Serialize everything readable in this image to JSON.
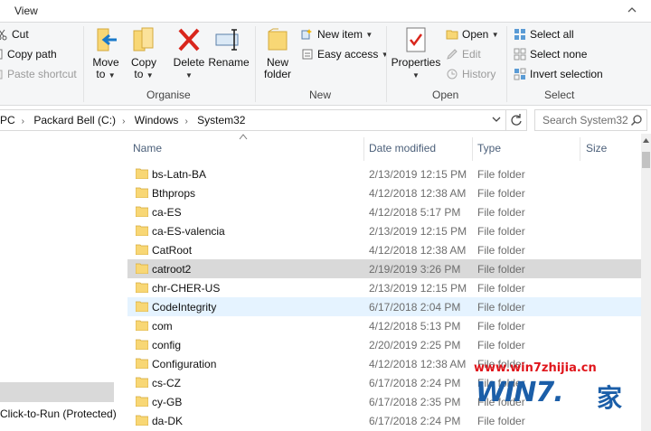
{
  "tabbar": {
    "view_tab": "View"
  },
  "ribbon": {
    "clipboard": {
      "cut": "Cut",
      "copy_path": "Copy path",
      "paste_shortcut": "Paste shortcut"
    },
    "organise": {
      "label": "Organise",
      "move_to": "Move",
      "move_to_2": "to",
      "copy_to": "Copy",
      "copy_to_2": "to",
      "delete": "Delete",
      "rename": "Rename"
    },
    "new": {
      "label": "New",
      "new_folder": "New",
      "new_folder_2": "folder",
      "new_item": "New item",
      "easy_access": "Easy access"
    },
    "open": {
      "label": "Open",
      "properties": "Properties",
      "open": "Open",
      "edit": "Edit",
      "history": "History"
    },
    "select": {
      "label": "Select",
      "select_all": "Select all",
      "select_none": "Select none",
      "invert": "Invert selection"
    }
  },
  "address": {
    "crumbs": [
      "PC",
      "Packard Bell (C:)",
      "Windows",
      "System32"
    ],
    "search_placeholder": "Search System32"
  },
  "navpane": {
    "bottom_item": "Click-to-Run (Protected)"
  },
  "list": {
    "headers": {
      "name": "Name",
      "date": "Date modified",
      "type": "Type",
      "size": "Size"
    },
    "rows": [
      {
        "name": "bs-Latn-BA",
        "date": "2/13/2019 12:15 PM",
        "type": "File folder"
      },
      {
        "name": "Bthprops",
        "date": "4/12/2018 12:38 AM",
        "type": "File folder"
      },
      {
        "name": "ca-ES",
        "date": "4/12/2018 5:17 PM",
        "type": "File folder"
      },
      {
        "name": "ca-ES-valencia",
        "date": "2/13/2019 12:15 PM",
        "type": "File folder"
      },
      {
        "name": "CatRoot",
        "date": "4/12/2018 12:38 AM",
        "type": "File folder"
      },
      {
        "name": "catroot2",
        "date": "2/19/2019 3:26 PM",
        "type": "File folder"
      },
      {
        "name": "chr-CHER-US",
        "date": "2/13/2019 12:15 PM",
        "type": "File folder"
      },
      {
        "name": "CodeIntegrity",
        "date": "6/17/2018 2:04 PM",
        "type": "File folder"
      },
      {
        "name": "com",
        "date": "4/12/2018 5:13 PM",
        "type": "File folder"
      },
      {
        "name": "config",
        "date": "2/20/2019 2:25 PM",
        "type": "File folder"
      },
      {
        "name": "Configuration",
        "date": "4/12/2018 12:38 AM",
        "type": "File folder"
      },
      {
        "name": "cs-CZ",
        "date": "6/17/2018 2:24 PM",
        "type": "File folder"
      },
      {
        "name": "cy-GB",
        "date": "6/17/2018 2:35 PM",
        "type": "File folder"
      },
      {
        "name": "da-DK",
        "date": "6/17/2018 2:24 PM",
        "type": "File folder"
      }
    ]
  },
  "watermark": {
    "url": "www.win7zhijia.cn",
    "logo": "WIN7.",
    "cn": "家"
  },
  "colors": {
    "folder": "#f8d775",
    "accent": "#1979ca",
    "selected_row": "#d9d9d9",
    "hover_row": "#e5f3ff",
    "delete_red": "#d9261c"
  }
}
